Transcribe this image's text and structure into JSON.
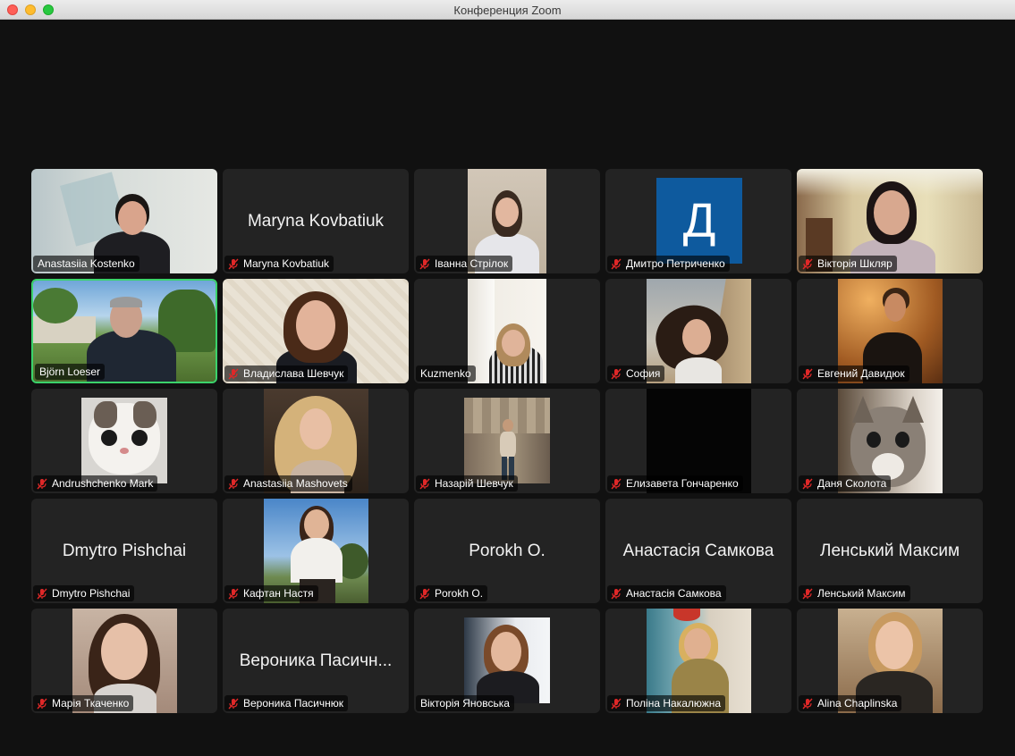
{
  "window": {
    "title": "Конференция Zoom"
  },
  "icons": {
    "muted_mic": "muted-microphone-icon"
  },
  "colors": {
    "active_speaker_border": "#3bd36b",
    "muted_icon": "#e02828",
    "tile_bg": "#232323"
  },
  "participants": [
    {
      "name": "Anastasiia Kostenko",
      "muted": false,
      "video": true
    },
    {
      "name": "Maryna Kovbatiuk",
      "muted": true,
      "video": false,
      "display_name": "Maryna Kovbatiuk"
    },
    {
      "name": "Іванна Стрілок",
      "muted": true,
      "video": true
    },
    {
      "name": "Дмитро Петриченко",
      "muted": true,
      "video": false,
      "avatar_letter": "Д"
    },
    {
      "name": "Вікторія Шкляр",
      "muted": true,
      "video": true
    },
    {
      "name": "Björn Loeser",
      "muted": false,
      "video": true,
      "active": true
    },
    {
      "name": "Владислава Шевчук",
      "muted": true,
      "video": true
    },
    {
      "name": "Kuzmenko",
      "muted": false,
      "video": true
    },
    {
      "name": "София",
      "muted": true,
      "video": true
    },
    {
      "name": "Евгений Давидюк",
      "muted": true,
      "video": true
    },
    {
      "name": "Andrushchenko Mark",
      "muted": true,
      "video": true
    },
    {
      "name": "Anastasiia Mashovets",
      "muted": true,
      "video": true
    },
    {
      "name": "Назарій Шевчук",
      "muted": true,
      "video": true
    },
    {
      "name": "Елизавета Гончаренко",
      "muted": true,
      "video": true
    },
    {
      "name": "Даня Сколота",
      "muted": true,
      "video": true
    },
    {
      "name": "Dmytro Pishchai",
      "muted": true,
      "video": false,
      "display_name": "Dmytro Pishchai"
    },
    {
      "name": "Кафтан Настя",
      "muted": true,
      "video": true
    },
    {
      "name": "Porokh O.",
      "muted": true,
      "video": false,
      "display_name": "Porokh O."
    },
    {
      "name": "Анастасія Самкова",
      "muted": true,
      "video": false,
      "display_name": "Анастасія Самкова"
    },
    {
      "name": "Ленський Максим",
      "muted": true,
      "video": false,
      "display_name": "Ленський Максим"
    },
    {
      "name": "Марія Ткаченко",
      "muted": true,
      "video": true
    },
    {
      "name": "Вероника Пасичнюк",
      "muted": true,
      "video": false,
      "display_name": "Вероника Пасичн..."
    },
    {
      "name": "Вікторія Яновська",
      "muted": false,
      "video": true
    },
    {
      "name": "Поліна Накалюжна",
      "muted": true,
      "video": true
    },
    {
      "name": "Alina Chaplinska",
      "muted": true,
      "video": true
    }
  ]
}
